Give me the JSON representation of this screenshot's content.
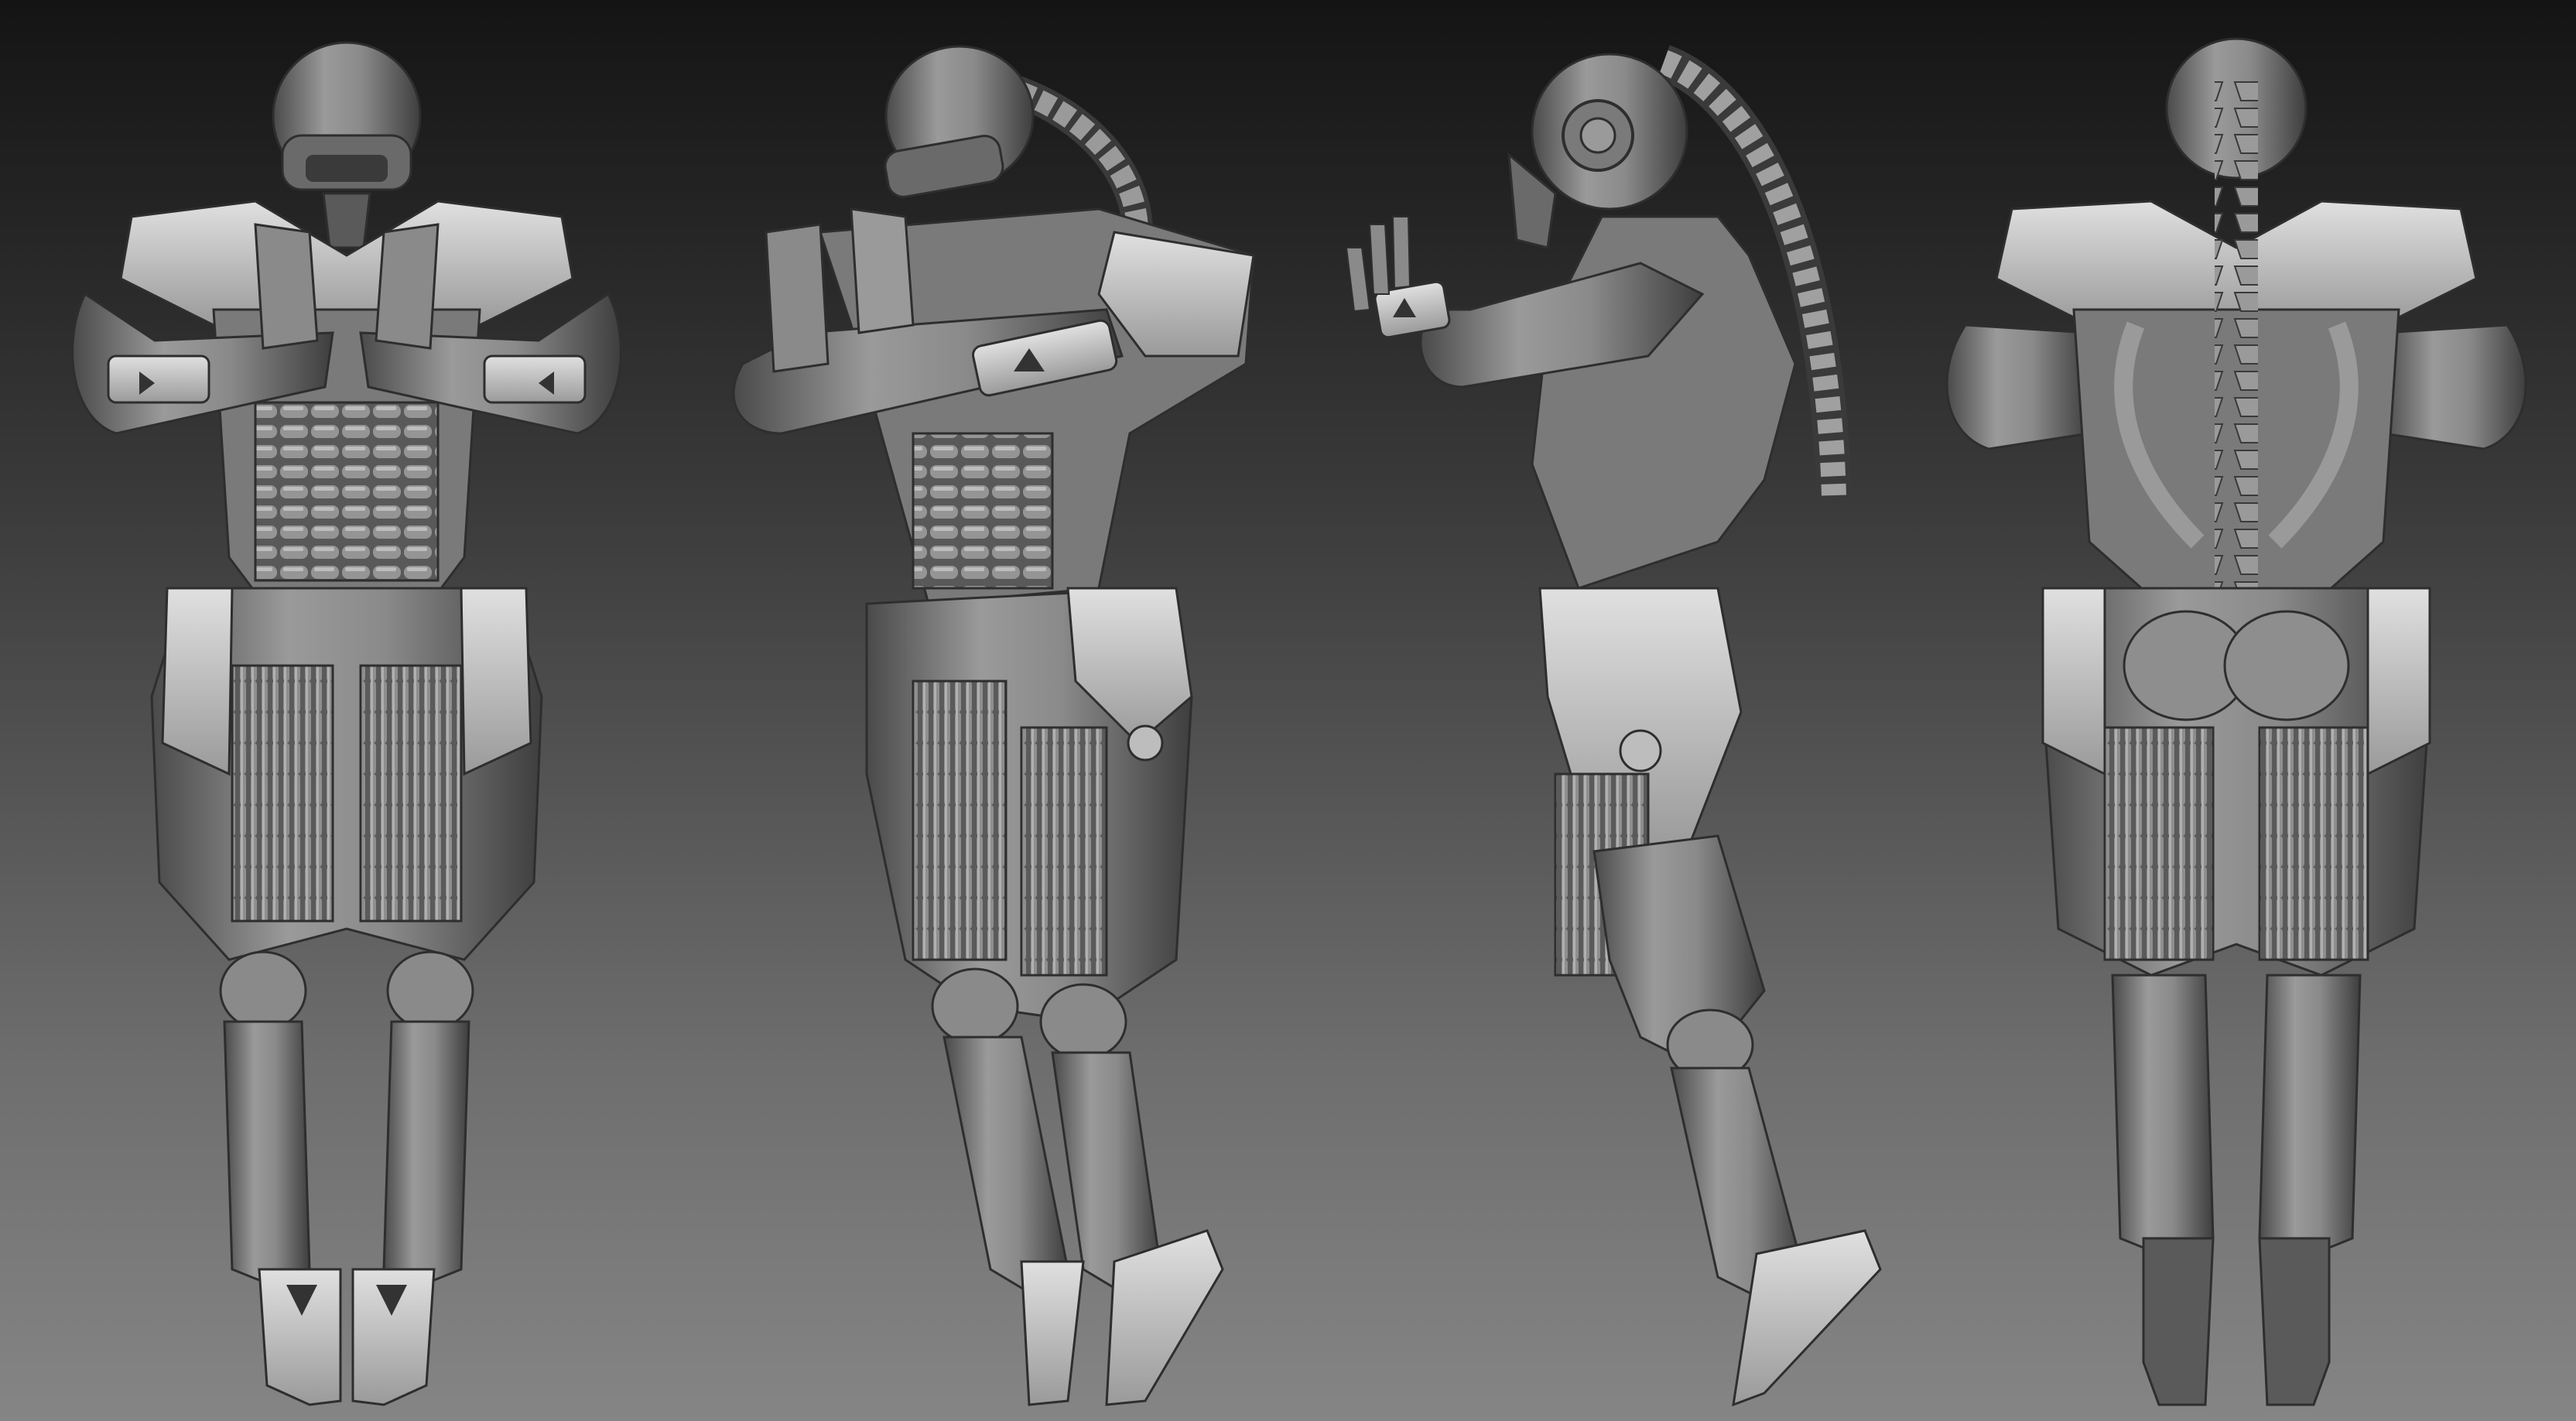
{
  "scene": {
    "description_visible_text": "",
    "background_gradient": {
      "top": "#141414",
      "bottom": "#858585"
    },
    "material": {
      "base": "#8c8c8c",
      "dark": "#3c3c3c",
      "mid": "#6a6a6a",
      "light": "#c8c8c8",
      "highlight": "#e6e6e6"
    },
    "views": [
      {
        "id": "front",
        "icon": "humanoid-front-view"
      },
      {
        "id": "three-quarter-front",
        "icon": "humanoid-three-quarter-view"
      },
      {
        "id": "side-back",
        "icon": "humanoid-side-view"
      },
      {
        "id": "back",
        "icon": "humanoid-back-view"
      }
    ]
  }
}
